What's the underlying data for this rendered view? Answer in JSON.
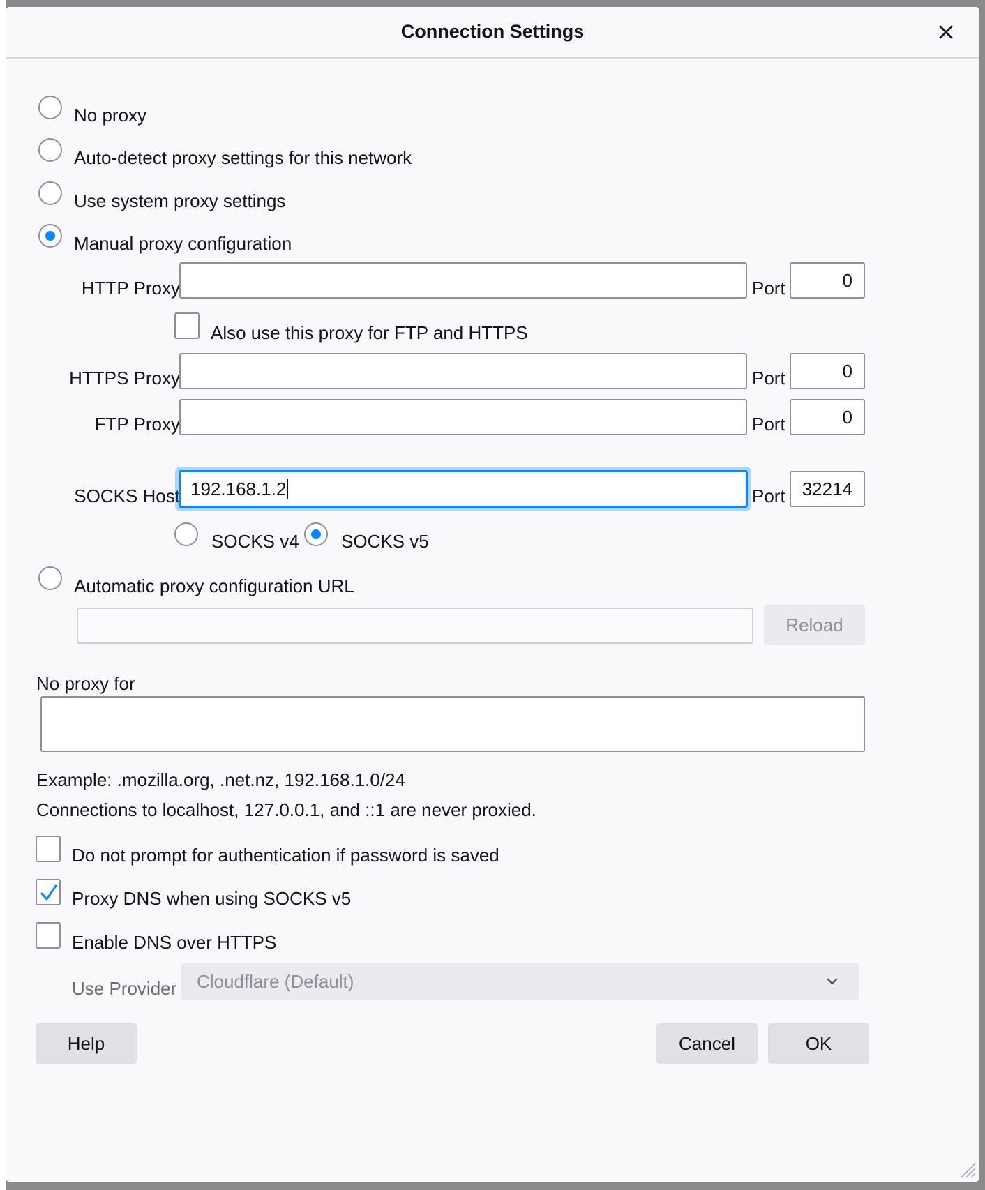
{
  "dialog": {
    "title": "Connection Settings"
  },
  "proxy_modes": {
    "no_proxy": "No proxy",
    "auto_detect": "Auto-detect proxy settings for this network",
    "system": "Use system proxy settings",
    "manual": "Manual proxy configuration",
    "selected": "manual"
  },
  "manual": {
    "http_label": "HTTP Proxy",
    "http_value": "",
    "http_port": "0",
    "also_use_label": "Also use this proxy for FTP and HTTPS",
    "also_use_checked": false,
    "https_label": "HTTPS Proxy",
    "https_value": "",
    "https_port": "0",
    "ftp_label": "FTP Proxy",
    "ftp_value": "",
    "ftp_port": "0",
    "socks_label": "SOCKS Host",
    "socks_value": "192.168.1.2",
    "socks_port": "32214",
    "port_label": "Port",
    "socks_v4": "SOCKS v4",
    "socks_v5": "SOCKS v5",
    "socks_selected": "v5"
  },
  "auto_config": {
    "label": "Automatic proxy configuration URL",
    "url": "",
    "reload": "Reload"
  },
  "no_proxy_for": {
    "label": "No proxy for",
    "value": "",
    "example": "Example: .mozilla.org, .net.nz, 192.168.1.0/24",
    "note": "Connections to localhost, 127.0.0.1, and ::1 are never proxied."
  },
  "options": {
    "no_prompt_auth": "Do not prompt for authentication if password is saved",
    "no_prompt_auth_checked": false,
    "proxy_dns": "Proxy DNS when using SOCKS v5",
    "proxy_dns_checked": true,
    "dns_over_https": "Enable DNS over HTTPS",
    "dns_over_https_checked": false,
    "use_provider_label": "Use Provider",
    "provider_value": "Cloudflare (Default)"
  },
  "buttons": {
    "help": "Help",
    "cancel": "Cancel",
    "ok": "OK"
  },
  "colors": {
    "accent": "#0a84ff",
    "dialog_bg": "#f9f9fb",
    "border": "#8f8f9d"
  }
}
